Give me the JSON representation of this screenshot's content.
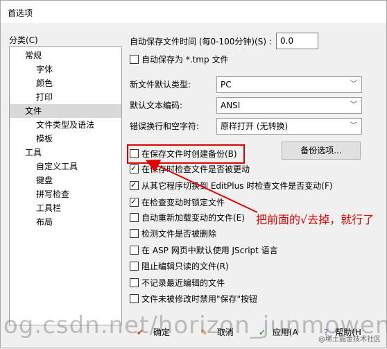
{
  "window": {
    "title": "首选项"
  },
  "categories": {
    "label": "分类(C)",
    "items": [
      {
        "label": "常规",
        "indent": 1
      },
      {
        "label": "字体",
        "indent": 2
      },
      {
        "label": "颜色",
        "indent": 2
      },
      {
        "label": "打印",
        "indent": 2
      },
      {
        "label": "文件",
        "indent": 1,
        "selected": true
      },
      {
        "label": "文件类型及语法",
        "indent": 2
      },
      {
        "label": "模板",
        "indent": 2
      },
      {
        "label": "工具",
        "indent": 1
      },
      {
        "label": "自定义工具",
        "indent": 2
      },
      {
        "label": "键盘",
        "indent": 2
      },
      {
        "label": "拼写检查",
        "indent": 2
      },
      {
        "label": "工具栏",
        "indent": 2
      },
      {
        "label": "布局",
        "indent": 2
      }
    ]
  },
  "autosave": {
    "interval_label": "自动保存文件时间 (每0-100分钟)(S) :",
    "interval_value": "0.0",
    "tmp_label": "自动保存为 *.tmp 文件",
    "tmp_checked": false
  },
  "defaults": {
    "file_type_label": "新文件默认类型:",
    "file_type_value": "PC",
    "encoding_label": "默认文本编码:",
    "encoding_value": "ANSI",
    "linebreak_label": "错误换行和空字符:",
    "linebreak_value": "原样打开 (无转换)"
  },
  "backup_options_button": "备份选项...",
  "checkboxes": [
    {
      "label": "在保存文件时创建备份(B)",
      "checked": false
    },
    {
      "label": "在保存时检查文件是否被更动",
      "checked": true
    },
    {
      "label": "从其它程序切换到 EditPlus 时检查文件是否变动(F)",
      "checked": true
    },
    {
      "label": "在检查变动时锁定文件",
      "checked": true
    },
    {
      "label": "自动重新加载变动的文件(E)",
      "checked": false
    },
    {
      "label": "检测文件是否被删除",
      "checked": false
    },
    {
      "label": "在 ASP 网页中默认使用 JScript 语言",
      "checked": false
    },
    {
      "label": "阻止编辑只读的文件(R)",
      "checked": false
    },
    {
      "label": "不记录最近编辑的文件",
      "checked": false
    },
    {
      "label": "文件未被修改时禁用\"保存\"按钮",
      "checked": false
    }
  ],
  "annotation": "把前面的√去掉，就行了",
  "footer": {
    "ok": "确定",
    "cancel": "取消",
    "apply": "应用(A",
    "help": "帮助(H"
  },
  "watermark": "og.csdn.net/horizon_junmowen",
  "corner_mark": "@稀土掘金技术社区",
  "colors": {
    "annotation": "#e00000",
    "selection": "#d9d9d9"
  }
}
